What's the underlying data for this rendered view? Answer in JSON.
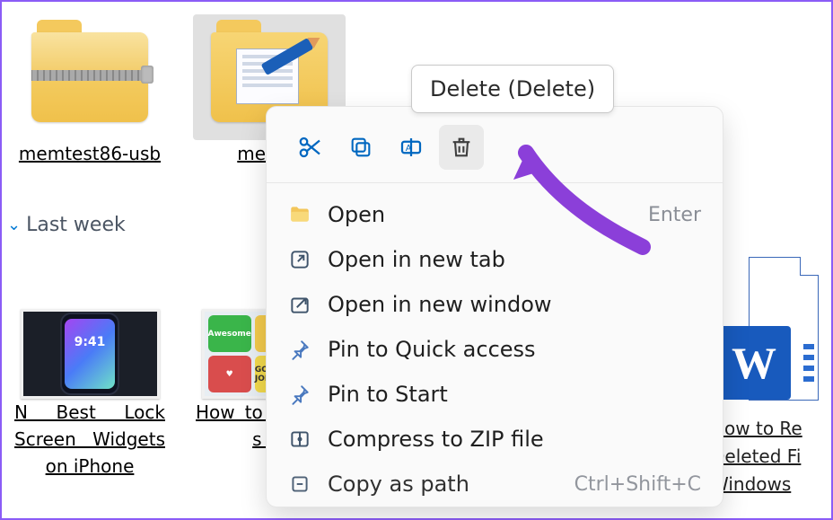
{
  "files": {
    "memtest_usb": {
      "label": "memtest86-usb"
    },
    "memtest_selected": {
      "label": "memte"
    }
  },
  "group": {
    "last_week": "Last week"
  },
  "thumbs": {
    "lock_screen": {
      "label": "N Best Lock Screen Widgets on iPhone",
      "time": "9:41"
    },
    "stickers": {
      "label": "How to stom Te s on "
    },
    "word": {
      "label": "How to Re Deleted Fi Windows ",
      "badge": "W"
    }
  },
  "tooltip": {
    "text": "Delete (Delete)"
  },
  "context_menu": {
    "actions": {
      "cut": "Cut",
      "copy": "Copy",
      "rename": "Rename",
      "delete": "Delete"
    },
    "items": {
      "open": {
        "label": "Open",
        "hint": "Enter"
      },
      "open_tab": {
        "label": "Open in new tab"
      },
      "open_window": {
        "label": "Open in new window"
      },
      "pin_quick": {
        "label": "Pin to Quick access"
      },
      "pin_start": {
        "label": "Pin to Start"
      },
      "compress": {
        "label": "Compress to ZIP file"
      },
      "copy_path": {
        "label": "Copy as path",
        "hint": "Ctrl+Shift+C"
      }
    }
  }
}
